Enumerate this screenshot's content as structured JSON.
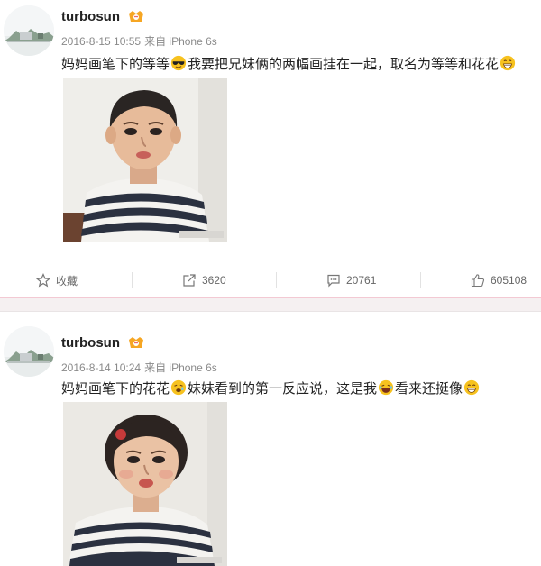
{
  "posts": [
    {
      "username": "turbosun",
      "timestamp": "2016-8-15 10:55",
      "source": "来自 iPhone 6s",
      "text_parts": [
        "妈妈画笔下的等等",
        "我要把兄妹俩的两幅画挂在一起，取名为等等和花花",
        ""
      ],
      "emojis": [
        "sunglasses-emoji",
        "grin-emoji"
      ],
      "image_alt": "boy-painting",
      "actions": {
        "favorite_label": "收藏",
        "share_count": "3620",
        "comment_count": "20761",
        "like_count": "605108"
      }
    },
    {
      "username": "turbosun",
      "timestamp": "2016-8-14 10:24",
      "source": "来自 iPhone 6s",
      "text_parts": [
        "妈妈画笔下的花花",
        "妹妹看到的第一反应说，这是我",
        "看来还挺像",
        ""
      ],
      "emojis": [
        "weary-emoji",
        "laughing-emoji",
        "grin-emoji"
      ],
      "image_alt": "girl-painting"
    }
  ],
  "colors": {
    "divider_pink": "#f3c9d3",
    "meta_gray": "#8a8a8a",
    "emoji_yellow": "#f7c21f"
  }
}
